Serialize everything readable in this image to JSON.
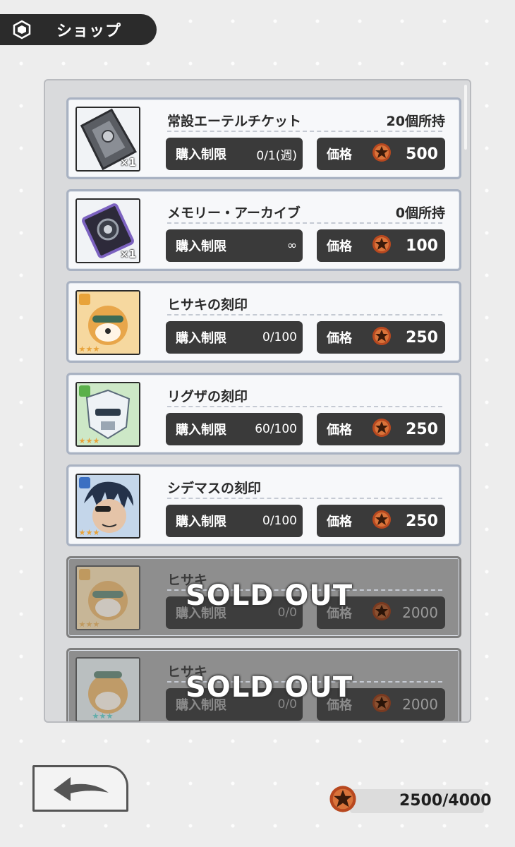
{
  "header": {
    "title": "ショップ"
  },
  "items": [
    {
      "name": "常設エーテルチケット",
      "owned": "20個所持",
      "qty": "×1",
      "limit_label": "購入制限",
      "limit": "0/1(週)",
      "price_label": "価格",
      "price": "500",
      "sold": false
    },
    {
      "name": "メモリー・アーカイブ",
      "owned": "0個所持",
      "qty": "×1",
      "limit_label": "購入制限",
      "limit": "∞",
      "price_label": "価格",
      "price": "100",
      "sold": false
    },
    {
      "name": "ヒサキの刻印",
      "owned": "",
      "qty": "",
      "limit_label": "購入制限",
      "limit": "0/100",
      "price_label": "価格",
      "price": "250",
      "sold": false
    },
    {
      "name": "リグザの刻印",
      "owned": "",
      "qty": "",
      "limit_label": "購入制限",
      "limit": "60/100",
      "price_label": "価格",
      "price": "250",
      "sold": false
    },
    {
      "name": "シデマスの刻印",
      "owned": "",
      "qty": "",
      "limit_label": "購入制限",
      "limit": "0/100",
      "price_label": "価格",
      "price": "250",
      "sold": false
    },
    {
      "name": "ヒサキ",
      "owned": "",
      "qty": "",
      "limit_label": "購入制限",
      "limit": "0/0",
      "price_label": "価格",
      "price": "2000",
      "sold": true,
      "sold_label": "SOLD OUT"
    },
    {
      "name": "ヒサキ",
      "owned": "",
      "qty": "",
      "limit_label": "購入制限",
      "limit": "0/0",
      "price_label": "価格",
      "price": "2000",
      "sold": true,
      "sold_label": "SOLD OUT"
    }
  ],
  "wallet": {
    "value": "2500/4000",
    "icon": "ether-coin-icon"
  },
  "icons": {
    "header": "hexagon-icon",
    "back": "back-arrow-icon",
    "price": "ether-coin-icon"
  },
  "colors": {
    "accent_dark": "#3a3a3a",
    "coin": "#c2562a"
  }
}
